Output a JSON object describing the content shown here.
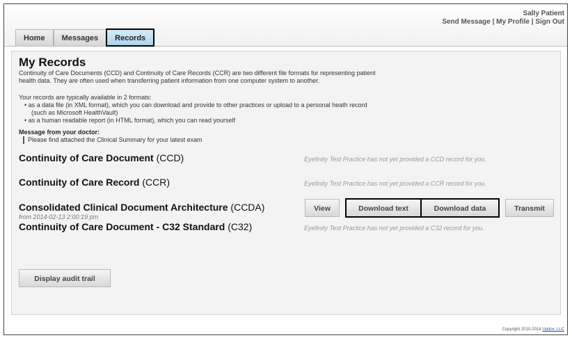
{
  "user": {
    "name": "Sally Patient",
    "send_message": "Send Message",
    "my_profile": "My Profile",
    "sign_out": "Sign Out",
    "separator": " | "
  },
  "tabs": [
    {
      "label": "Home",
      "active": false
    },
    {
      "label": "Messages",
      "active": false
    },
    {
      "label": "Records",
      "active": true
    }
  ],
  "page": {
    "title": "My Records",
    "intro_line1": "Continuity of Care Documents (CCD) and Continuity of Care Records (CCR) are two different file formats for representing patient",
    "intro_line2": "health data. They are often used when transferring patient information from one computer system to another.",
    "formats_intro": "Your records are typically available in 2 formats:",
    "format_1_line1": "as a data file (in XML format), which you can download and provide to other practices or upload to a personal heath record",
    "format_1_line2": "(such as Microsoft HealthVault)",
    "format_2": "as a human readable report (in HTML format), which you can read yourself",
    "message_title": "Message from your doctor:",
    "message_body": "Please find attached the Clinical Summary for your latest exam"
  },
  "records": {
    "ccd": {
      "title": "Continuity of Care Document",
      "abbr": "(CCD)",
      "note": "Eyefinity Test Practice has not yet provided a CCD record for you."
    },
    "ccr": {
      "title": "Continuity of Care Record",
      "abbr": "(CCR)",
      "note": "Eyefinity Test Practice has not yet provided a CCR record for you."
    },
    "ccda": {
      "title": "Consolidated Clinical Document Architecture",
      "abbr": "(CCDA)",
      "date": "from 2014-02-13 2:00:19 pm",
      "view": "View",
      "download_text": "Download text",
      "download_data": "Download data",
      "transmit": "Transmit"
    },
    "c32": {
      "title": "Continuity of Care Document - C32 Standard",
      "abbr": "(C32)",
      "note": "Eyefinity Test Practice has not yet provided a C32 record for you."
    }
  },
  "audit_button": "Display audit trail",
  "footer": {
    "copyright": "Copyright 2010-2014",
    "link": "Updox, LLC"
  }
}
